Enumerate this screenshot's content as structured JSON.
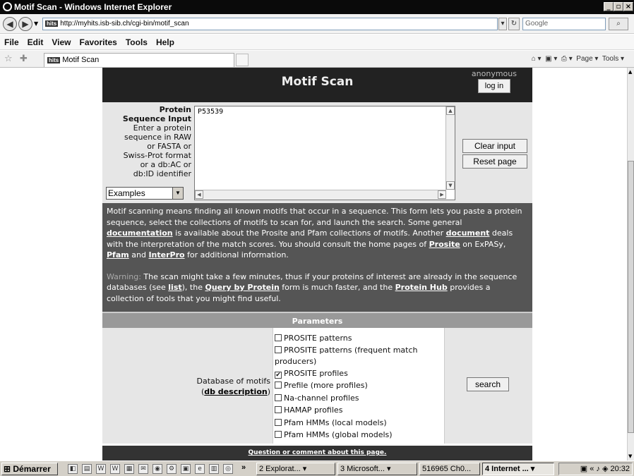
{
  "window": {
    "title": "Motif Scan - Windows Internet Explorer",
    "min": "_",
    "max": "▫",
    "close": "×"
  },
  "address_bar": {
    "url": "http://myhits.isb-sib.ch/cgi-bin/motif_scan",
    "favicon": "hits",
    "search_placeholder": "Google"
  },
  "menu": [
    "File",
    "Edit",
    "View",
    "Favorites",
    "Tools",
    "Help"
  ],
  "tab": {
    "title": "Motif Scan",
    "favicon": "hits"
  },
  "command_bar": {
    "page": "Page ▾",
    "tools": "Tools ▾"
  },
  "header": {
    "title": "Motif Scan",
    "user": "anonymous",
    "login": "log in"
  },
  "input_section": {
    "label_title_1": "Protein",
    "label_title_2": "Sequence Input",
    "label_lines": [
      "Enter a protein",
      "sequence in RAW",
      "or FASTA or",
      "Swiss-Prot format",
      "or a db:AC or",
      "db:ID identifier"
    ],
    "examples_select": "Examples",
    "sequence_value": "P53539",
    "clear_button": "Clear input",
    "reset_button": "Reset page"
  },
  "intro": {
    "t1": "Motif scanning means finding all known motifs that occur in a sequence. This form lets you paste a protein sequence, select the collections of motifs to scan for, and launch the search. Some general ",
    "link_documentation": "documentation",
    "t2": " is available about the Prosite and Pfam collections of motifs. Another ",
    "link_document": "document",
    "t3": " deals with the interpretation of the match scores. You should consult the home pages of ",
    "link_prosite": "Prosite",
    "t4": " on ExPASy, ",
    "link_pfam": "Pfam",
    "t5": " and ",
    "link_interpro": "InterPro",
    "t6": " for additional information.",
    "warning_label": "Warning:",
    "w1": " The scan might take a few minutes, thus if your proteins of interest are already in the sequence databases (see ",
    "link_list": "list",
    "w2": "), the ",
    "link_query": "Query by Protein",
    "w3": " form is much faster, and the ",
    "link_hub": "Protein Hub",
    "w4": " provides a collection of tools that you might find useful."
  },
  "parameters": {
    "heading": "Parameters",
    "db_label": "Database of motifs",
    "db_link": "db description",
    "options": [
      {
        "label": "PROSITE patterns",
        "checked": false
      },
      {
        "label": "PROSITE patterns (frequent match producers)",
        "checked": false
      },
      {
        "label": "PROSITE profiles",
        "checked": true
      },
      {
        "label": "Prefile (more profiles)",
        "checked": false
      },
      {
        "label": "Na-channel profiles",
        "checked": false
      },
      {
        "label": "HAMAP profiles",
        "checked": false
      },
      {
        "label": "Pfam HMMs (local models)",
        "checked": false
      },
      {
        "label": "Pfam HMMs (global models)",
        "checked": false
      }
    ],
    "search_button": "search"
  },
  "footer": {
    "link": "Question or comment about this page."
  },
  "taskbar": {
    "start": "Démarrer",
    "tasks": [
      "2 Explorat... ▾",
      "3 Microsoft... ▾",
      "516965 Ch0...",
      "4 Internet ... ▾"
    ],
    "clock": "20:32"
  }
}
